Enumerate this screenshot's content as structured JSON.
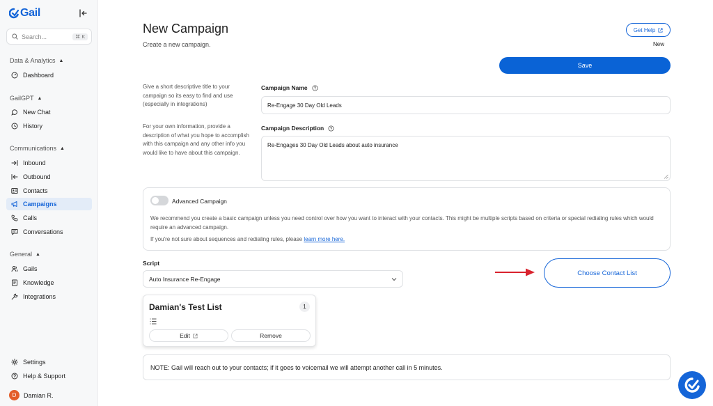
{
  "app": {
    "brand": "Gail",
    "brand_color": "#1565d8"
  },
  "sidebar": {
    "search_placeholder": "Search...",
    "search_shortcut": "⌘ K",
    "sections": [
      {
        "title": "Data & Analytics",
        "items": [
          {
            "label": "Dashboard",
            "icon": "dashboard-icon"
          }
        ]
      },
      {
        "title": "GailGPT",
        "items": [
          {
            "label": "New Chat",
            "icon": "chat-icon"
          },
          {
            "label": "History",
            "icon": "history-icon"
          }
        ]
      },
      {
        "title": "Communications",
        "items": [
          {
            "label": "Inbound",
            "icon": "inbound-icon"
          },
          {
            "label": "Outbound",
            "icon": "outbound-icon"
          },
          {
            "label": "Contacts",
            "icon": "contacts-icon"
          },
          {
            "label": "Campaigns",
            "icon": "megaphone-icon",
            "active": true
          },
          {
            "label": "Calls",
            "icon": "phone-icon"
          },
          {
            "label": "Conversations",
            "icon": "conversation-icon"
          }
        ]
      },
      {
        "title": "General",
        "items": [
          {
            "label": "Gails",
            "icon": "users-icon"
          },
          {
            "label": "Knowledge",
            "icon": "book-icon"
          },
          {
            "label": "Integrations",
            "icon": "wrench-icon"
          }
        ]
      }
    ],
    "footer": [
      {
        "label": "Settings",
        "icon": "gear-icon"
      },
      {
        "label": "Help & Support",
        "icon": "help-icon"
      }
    ],
    "user": {
      "initial": "D",
      "name": "Damian R."
    }
  },
  "header": {
    "title": "New Campaign",
    "subtitle": "Create a new campaign.",
    "help_label": "Get Help",
    "status": "New",
    "save_label": "Save"
  },
  "form": {
    "name_helper": "Give a short descriptive title to your campaign so its easy to find and use (especially in integrations)",
    "name_label": "Campaign Name",
    "name_value": "Re-Engage 30 Day Old Leads",
    "desc_helper": "For your own information, provide a description of what you hope to accomplish with this campaign and any other info you would like to have about this campaign.",
    "desc_label": "Campaign Description",
    "desc_value": "Re-Engages 30 Day Old Leads about auto insurance",
    "advanced": {
      "label": "Advanced Campaign",
      "enabled": false,
      "description": "We recommend you create a basic campaign unless you need control over how you want to interact with your contacts. This might be multiple scripts based on criteria or special redialing rules which would require an advanced campaign.",
      "note_prefix": "If you're not sure about sequences and redialing rules, please",
      "note_link": "learn more here."
    },
    "script_label": "Script",
    "script_value": "Auto Insurance Re-Engage",
    "choose_contact_label": "Choose Contact List",
    "contact_list": {
      "name": "Damian's Test List",
      "count": "1",
      "edit_label": "Edit",
      "remove_label": "Remove"
    },
    "note": "NOTE: Gail will reach out to your contacts; if it goes to voicemail we will attempt another call in 5 minutes."
  },
  "colors": {
    "primary": "#0a63d6",
    "arrow": "#d9232e",
    "active_bg": "#e3ecf8"
  }
}
